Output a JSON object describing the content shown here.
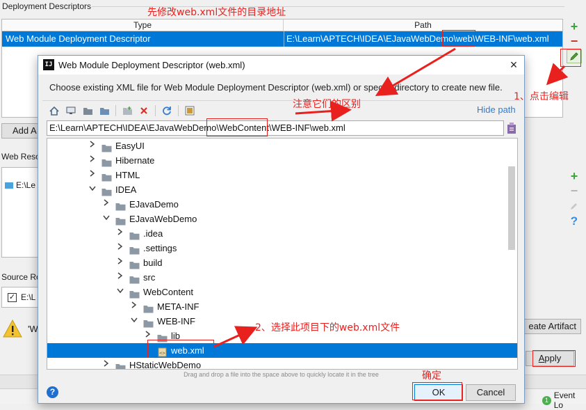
{
  "background": {
    "section_title": "Deployment Descriptors",
    "table": {
      "columns": [
        "Type",
        "Path"
      ],
      "row": {
        "type": "Web Module Deployment Descriptor",
        "path": "E:\\Learn\\APTECH\\IDEA\\EJavaWebDemo\\web\\WEB-INF\\web.xml"
      }
    },
    "add_button": "Add A",
    "web_resource_label": "Web Reso",
    "web_resource_row": "E:\\Le",
    "source_root_label": "Source Ro",
    "source_root_row": "E:\\L",
    "source_root_checked": "✓",
    "warning_text": "'W",
    "create_artifact_button": "eate Artifact",
    "apply_button_prefix": "",
    "apply_button_mnemonic": "A",
    "apply_button_rest": "pply",
    "event_log_count": "1",
    "event_log_label": "Event Lo",
    "icons": [
      "plus-icon",
      "minus-icon",
      "pencil-icon",
      "help-icon",
      "warning-icon"
    ]
  },
  "dialog": {
    "title": "Web Module Deployment Descriptor (web.xml)",
    "app_icon": "IJ",
    "close": "×",
    "description": "Choose existing XML file for Web Module Deployment Descriptor (web.xml) or specify directory to create new file.",
    "hide_path": "Hide path",
    "path_value": "E:\\Learn\\APTECH\\IDEA\\EJavaWebDemo\\WebContent\\WEB-INF\\web.xml",
    "tree": [
      {
        "label": "EasyUI",
        "depth": 0,
        "expanded": false
      },
      {
        "label": "Hibernate",
        "depth": 0,
        "expanded": false
      },
      {
        "label": "HTML",
        "depth": 0,
        "expanded": false
      },
      {
        "label": "IDEA",
        "depth": 0,
        "expanded": true
      },
      {
        "label": "EJavaDemo",
        "depth": 1,
        "expanded": false
      },
      {
        "label": "EJavaWebDemo",
        "depth": 1,
        "expanded": true
      },
      {
        "label": ".idea",
        "depth": 2,
        "expanded": false
      },
      {
        "label": ".settings",
        "depth": 2,
        "expanded": false
      },
      {
        "label": "build",
        "depth": 2,
        "expanded": false
      },
      {
        "label": "src",
        "depth": 2,
        "expanded": false
      },
      {
        "label": "WebContent",
        "depth": 2,
        "expanded": true
      },
      {
        "label": "META-INF",
        "depth": 3,
        "expanded": false
      },
      {
        "label": "WEB-INF",
        "depth": 3,
        "expanded": true
      },
      {
        "label": "lib",
        "depth": 4,
        "expanded": false
      },
      {
        "label": "web.xml",
        "depth": 4,
        "file": true,
        "selected": true
      },
      {
        "label": "HStaticWebDemo",
        "depth": 1,
        "expanded": false
      }
    ],
    "drag_hint": "Drag and drop a file into the space above to quickly locate it in the tree",
    "ok_button": "OK",
    "cancel_button": "Cancel",
    "help_button": "?"
  },
  "annotations": {
    "top_note": "先修改web.xml文件的目录地址",
    "edit_note": "1、点击编辑",
    "diff_note": "注意它们的区别",
    "select_note": "2、选择此项目下的web.xml文件",
    "confirm_note": "确定"
  },
  "colors": {
    "selection": "#0078d7",
    "annotation_red": "#e8211e",
    "link_blue": "#2f7bd6",
    "plus_green": "#3aa53a"
  }
}
